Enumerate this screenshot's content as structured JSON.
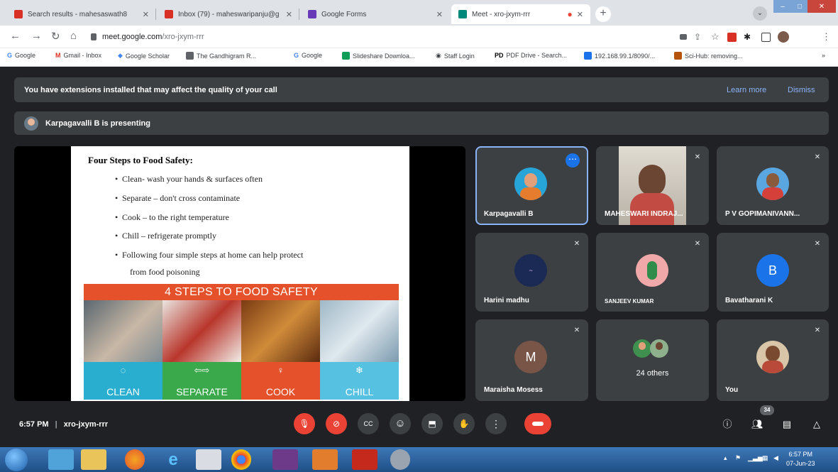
{
  "browser": {
    "tabs": [
      {
        "title": "Search results - mahesaswath8",
        "favicon_color": "#d93025"
      },
      {
        "title": "Inbox (79) - maheswaripanju@g",
        "favicon_color": "#d93025"
      },
      {
        "title": "Google Forms",
        "favicon_color": "#673ab7"
      },
      {
        "title": "Meet - xro-jxym-rrr",
        "favicon_color": "#00897b",
        "active": true
      }
    ],
    "url_host": "meet.google.com",
    "url_path": "/xro-jxym-rrr",
    "bookmarks": [
      {
        "label": "Google",
        "icon": "google-g-icon",
        "color": "#4285f4"
      },
      {
        "label": "Gmail - Inbox",
        "icon": "gmail-icon",
        "color": "#d93025"
      },
      {
        "label": "Google Scholar",
        "icon": "scholar-icon",
        "color": "#4285f4"
      },
      {
        "label": "The Gandhigram R...",
        "icon": "page-icon",
        "color": "#5f6368"
      },
      {
        "label": "Google",
        "icon": "google-g-icon",
        "color": "#4285f4"
      },
      {
        "label": "Slideshare Downloa...",
        "icon": "folder-icon",
        "color": "#0f9d58"
      },
      {
        "label": "Staff Login",
        "icon": "globe-icon",
        "color": "#5f6368"
      },
      {
        "label": "PDF Drive - Search...",
        "icon": "pd-icon",
        "color": "#000000"
      },
      {
        "label": "192.168.99.1/8090/...",
        "icon": "square-icon",
        "color": "#1a73e8"
      },
      {
        "label": "Sci-Hub: removing...",
        "icon": "scihub-icon",
        "color": "#b45309"
      }
    ]
  },
  "meet": {
    "banner_text": "You have extensions installed that may affect the quality of your call",
    "learn_more": "Learn more",
    "dismiss": "Dismiss",
    "presenting_text": "Karpagavalli B is presenting",
    "slide": {
      "title": "Four Steps to Food Safety:",
      "bullets": [
        "Clean- wash your hands & surfaces often",
        "Separate – don't cross contaminate",
        "Cook – to the right temperature",
        "Chill – refrigerate promptly",
        "Following four simple steps at home can help protect"
      ],
      "bullet_continuation": "from food poisoning",
      "graphic_heading": "4 STEPS TO FOOD SAFETY",
      "steps": [
        {
          "label": "CLEAN",
          "color": "#2aaed0"
        },
        {
          "label": "SEPARATE",
          "color": "#3aa94b"
        },
        {
          "label": "COOK",
          "color": "#e4512a"
        },
        {
          "label": "CHILL",
          "color": "#56c1e0"
        }
      ]
    },
    "participants": [
      {
        "name": "Karpagavalli B",
        "avatar": "photo",
        "active": true
      },
      {
        "name": "MAHESWARI INDRAJ...",
        "avatar": "video"
      },
      {
        "name": "P V GOPIMANIVANN...",
        "avatar": "photo"
      },
      {
        "name": "Harini madhu",
        "avatar": "logo"
      },
      {
        "name": "SANJEEV KUMAR",
        "avatar": "photo"
      },
      {
        "name": "Bavatharani K",
        "avatar": "letter",
        "letter": "B",
        "color": "#1a73e8"
      },
      {
        "name": "Maraisha Mosess",
        "avatar": "letter",
        "letter": "M",
        "color": "#795548"
      },
      {
        "name": "24 others",
        "avatar": "group"
      },
      {
        "name": "You",
        "avatar": "photo"
      }
    ],
    "time": "6:57 PM",
    "separator": "|",
    "meeting_code": "xro-jxym-rrr",
    "people_count": "34"
  },
  "taskbar": {
    "time": "6:57 PM",
    "date": "07-Jun-23"
  },
  "colors": {
    "meet_bg": "#202124",
    "tile_bg": "#3c4043",
    "accent_blue": "#8ab4f8",
    "red": "#ea4335"
  }
}
